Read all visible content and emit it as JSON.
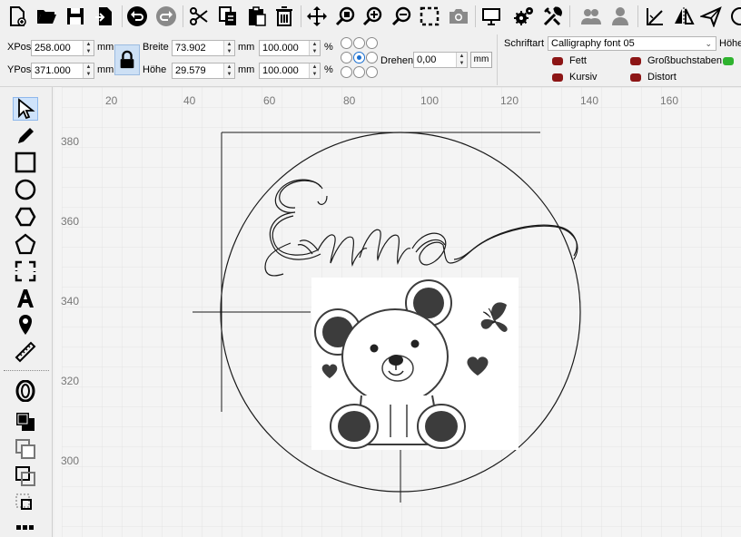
{
  "toolbar": {
    "icons": [
      "new-file-icon",
      "open-folder-icon",
      "save-icon",
      "import-icon",
      "undo-icon",
      "redo-icon",
      "cut-icon",
      "copy-icon",
      "paste-icon",
      "delete-icon",
      "move-icon",
      "zoom-page-icon",
      "zoom-in-icon",
      "zoom-out-icon",
      "select-frame-icon",
      "camera-icon",
      "monitor-icon",
      "settings-icon",
      "tools-icon",
      "users-icon",
      "user-icon",
      "align-icon",
      "mirror-icon",
      "send-icon"
    ]
  },
  "props": {
    "xpos_label": "XPos",
    "xpos_value": "258.000",
    "ypos_label": "YPos",
    "ypos_value": "371.000",
    "unit": "mm",
    "width_label": "Breite",
    "width_value": "73.902",
    "height_label": "Höhe",
    "height_value": "29.579",
    "scale_x": "100.000",
    "scale_y": "100.000",
    "percent": "%",
    "rotate_label": "Drehen",
    "rotate_value": "0,00",
    "mm_button": "mm"
  },
  "font": {
    "label": "Schriftart",
    "value": "Calligraphy font 05",
    "height_label": "Höhe",
    "bold_label": "Fett",
    "italic_label": "Kursiv",
    "caps_label": "Großbuchstaben",
    "distort_label": "Distort"
  },
  "ruler": {
    "x_labels": [
      "20",
      "40",
      "60",
      "80",
      "100",
      "120",
      "140",
      "160"
    ],
    "y_labels": [
      "380",
      "360",
      "340",
      "320",
      "300"
    ]
  },
  "canvas": {
    "text_content": "Emma",
    "colors": {
      "line": "#1a1a1a",
      "grid": "#e6e6e6",
      "fill": "#3c3c3c"
    }
  }
}
